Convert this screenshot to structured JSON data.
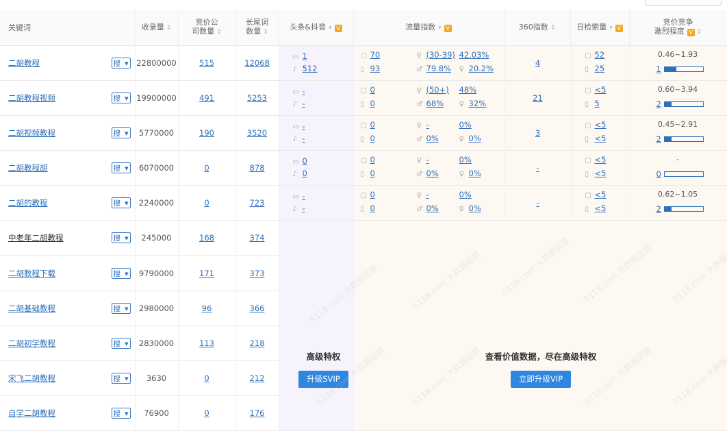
{
  "headers": {
    "keyword": "关键词",
    "index_volume": "收录量",
    "bid_companies": [
      "竞价公",
      "司数量"
    ],
    "long_tail": [
      "长尾词",
      "数量"
    ],
    "toutiao_douyin": "头条&抖音",
    "traffic_index": "流量指数",
    "index_360": "360指数",
    "daily_search": "日检索量",
    "competition": [
      "竞价竞争",
      "激烈程度"
    ]
  },
  "search_label": "搜",
  "rows": [
    {
      "kw": "二胡教程",
      "vol": "22800000",
      "bid": "515",
      "tail": "12068",
      "tt": "1",
      "dy": "512",
      "pc": "70",
      "mob": "93",
      "age": "(30-39)",
      "age_pct": "42.03%",
      "male": "79.8%",
      "female": "20.2%",
      "i360": "4",
      "d1": "52",
      "d2": "25",
      "range": "0.46~1.93",
      "level": "1",
      "level_fill": 0.3
    },
    {
      "kw": "二胡教程视频",
      "vol": "19900000",
      "bid": "491",
      "tail": "5253",
      "tt": "-",
      "dy": "-",
      "pc": "0",
      "mob": "0",
      "age": "(50+)",
      "age_pct": "48%",
      "male": "68%",
      "female": "32%",
      "i360": "21",
      "d1": "<5",
      "d2": "5",
      "range": "0.60~3.94",
      "level": "2",
      "level_fill": 0.18
    },
    {
      "kw": "二胡视频教程",
      "vol": "5770000",
      "bid": "190",
      "tail": "3520",
      "tt": "-",
      "dy": "-",
      "pc": "0",
      "mob": "0",
      "age": "-",
      "age_pct": "0%",
      "male": "0%",
      "female": "0%",
      "i360": "3",
      "d1": "<5",
      "d2": "<5",
      "range": "0.45~2.91",
      "level": "2",
      "level_fill": 0.18
    },
    {
      "kw": "二胡教程胡",
      "vol": "6070000",
      "bid": "0",
      "tail": "878",
      "tt": "0",
      "dy": "0",
      "pc": "0",
      "mob": "0",
      "age": "-",
      "age_pct": "0%",
      "male": "0%",
      "female": "0%",
      "i360": "-",
      "d1": "<5",
      "d2": "<5",
      "range": "-",
      "level": "0",
      "level_fill": 0
    },
    {
      "kw": "二胡的教程",
      "vol": "2240000",
      "bid": "0",
      "tail": "723",
      "tt": "-",
      "dy": "-",
      "pc": "0",
      "mob": "0",
      "age": "-",
      "age_pct": "0%",
      "male": "0%",
      "female": "0%",
      "i360": "-",
      "d1": "<5",
      "d2": "<5",
      "range": "0.62~1.05",
      "level": "2",
      "level_fill": 0.18
    },
    {
      "kw": "中老年二胡教程",
      "vol": "245000",
      "bid": "168",
      "tail": "374",
      "plain": true
    },
    {
      "kw": "二胡教程下载",
      "vol": "9790000",
      "bid": "171",
      "tail": "373"
    },
    {
      "kw": "二胡基础教程",
      "vol": "2980000",
      "bid": "96",
      "tail": "366"
    },
    {
      "kw": "二胡初学教程",
      "vol": "2830000",
      "bid": "113",
      "tail": "218"
    },
    {
      "kw": "宋飞二胡教程",
      "vol": "3630",
      "bid": "0",
      "tail": "212"
    },
    {
      "kw": "自学二胡教程",
      "vol": "76900",
      "bid": "0",
      "tail": "176"
    }
  ],
  "overlay_left": {
    "title": "高级特权",
    "button": "升级SVIP"
  },
  "overlay_right": {
    "title": "查看价值数据，尽在高级特权",
    "button": "立即升级VIP"
  },
  "watermark": "5118.com 大数据运营"
}
